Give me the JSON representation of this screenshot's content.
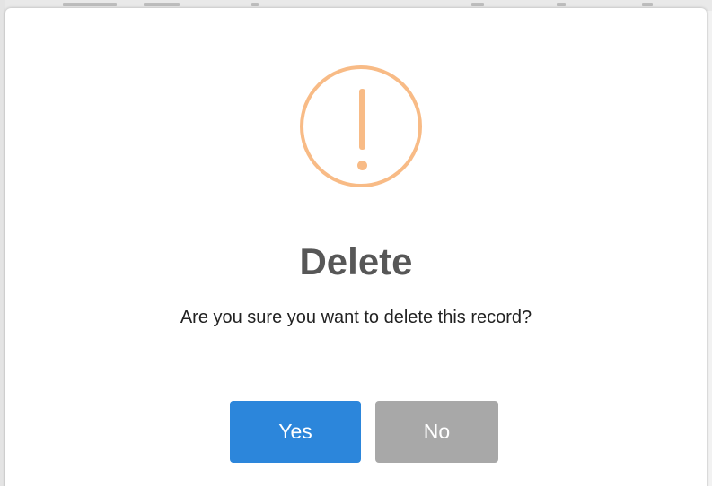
{
  "dialog": {
    "icon": "warning-exclamation-icon",
    "title": "Delete",
    "message": "Are you sure you want to delete this record?",
    "confirm_label": "Yes",
    "cancel_label": "No"
  },
  "colors": {
    "icon": "#f8bb86",
    "confirm": "#2c86db",
    "cancel": "#a8a8a8",
    "title": "#575757"
  }
}
